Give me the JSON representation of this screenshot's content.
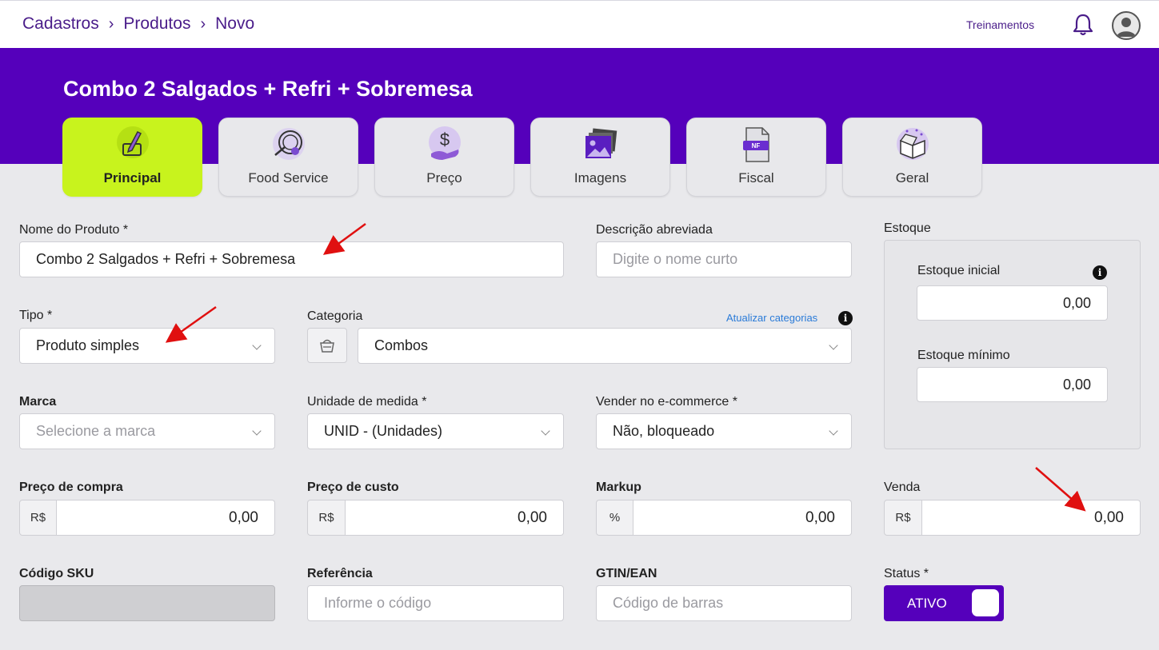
{
  "breadcrumb": {
    "items": [
      "Cadastros",
      "Produtos",
      "Novo"
    ]
  },
  "header": {
    "trainings": "Treinamentos"
  },
  "product": {
    "title": "Combo 2 Salgados + Refri + Sobremesa"
  },
  "tabs": [
    {
      "label": "Principal",
      "icon": "pencil-icon",
      "active": true
    },
    {
      "label": "Food Service",
      "icon": "plate-cutlery-icon",
      "active": false
    },
    {
      "label": "Preço",
      "icon": "dollar-hand-icon",
      "active": false
    },
    {
      "label": "Imagens",
      "icon": "images-icon",
      "active": false
    },
    {
      "label": "Fiscal",
      "icon": "invoice-nf-icon",
      "active": false
    },
    {
      "label": "Geral",
      "icon": "box-icon",
      "active": false
    }
  ],
  "form": {
    "name": {
      "label": "Nome do Produto *",
      "value": "Combo 2 Salgados + Refri + Sobremesa"
    },
    "short_desc": {
      "label": "Descrição abreviada",
      "placeholder": "Digite o nome curto"
    },
    "type": {
      "label": "Tipo *",
      "value": "Produto simples"
    },
    "category": {
      "label": "Categoria",
      "update_link": "Atualizar categorias",
      "value": "Combos"
    },
    "brand": {
      "label": "Marca",
      "placeholder": "Selecione a marca"
    },
    "unit": {
      "label": "Unidade de medida *",
      "value": "UNID - (Unidades)"
    },
    "ecommerce": {
      "label": "Vender no e-commerce *",
      "value": "Não, bloqueado"
    },
    "purchase_price": {
      "label": "Preço de compra",
      "prefix": "R$",
      "value": "0,00"
    },
    "cost_price": {
      "label": "Preço de custo",
      "prefix": "R$",
      "value": "0,00"
    },
    "markup": {
      "label": "Markup",
      "prefix": "%",
      "value": "0,00"
    },
    "sale": {
      "label": "Venda",
      "prefix": "R$",
      "value": "0,00"
    },
    "sku": {
      "label": "Código SKU"
    },
    "reference": {
      "label": "Referência",
      "placeholder": "Informe o código"
    },
    "gtin": {
      "label": "GTIN/EAN",
      "placeholder": "Código de barras"
    },
    "status": {
      "label": "Status *",
      "value": "ATIVO"
    }
  },
  "stock": {
    "title": "Estoque",
    "initial_label": "Estoque inicial",
    "initial_value": "0,00",
    "min_label": "Estoque mínimo",
    "min_value": "0,00"
  },
  "colors": {
    "brand_purple": "#5500bb",
    "active_tab": "#c8f31d",
    "link_blue": "#2a7bd8",
    "annotation_red": "#e01010"
  }
}
